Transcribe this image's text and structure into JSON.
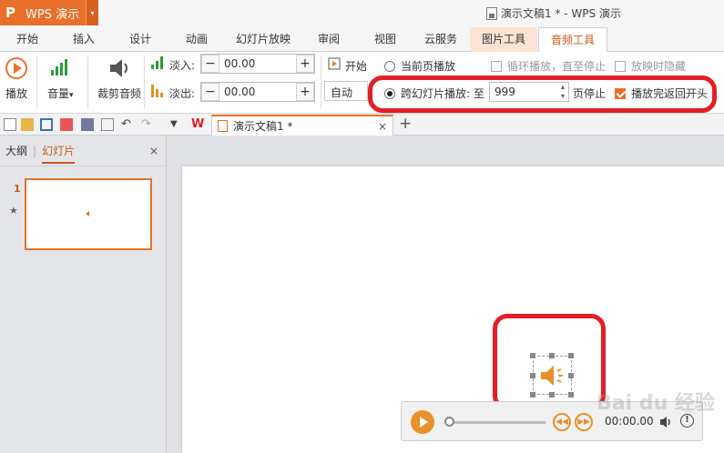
{
  "app": {
    "name": "WPS 演示",
    "logo_glyph": "P",
    "dropdown_glyph": "▾",
    "window_title": "演示文稿1 * - WPS 演示"
  },
  "tabs": [
    "开始",
    "插入",
    "设计",
    "动画",
    "幻灯片放映",
    "审阅",
    "视图",
    "云服务",
    "图片工具",
    "音频工具"
  ],
  "ribbon": {
    "play_label": "播放",
    "volume_label": "音量",
    "volume_arrow": "▾",
    "trim_label": "裁剪音频",
    "fade_in_label": "淡入:",
    "fade_in_value": "00.00",
    "fade_out_label": "淡出:",
    "fade_out_value": "00.00",
    "minus": "−",
    "plus": "+",
    "start_label": "开始",
    "start_mode": "自动",
    "current_page_label": "当前页播放",
    "cross_slide_label": "跨幻灯片播放: 至",
    "cross_slide_value": "999",
    "page_stop_label": "页停止",
    "loop_label": "循环播放，直至停止",
    "hide_label": "放映时隐藏",
    "rewind_label": "播放完返回开头",
    "spin_up": "▴",
    "spin_down": "▾"
  },
  "quickbar": {
    "doc_tab": "演示文稿1 *",
    "close": "×",
    "new_tab": "+"
  },
  "left_pane": {
    "outline_tab": "大纲",
    "divider": "|",
    "slides_tab": "幻灯片",
    "close": "×",
    "slide_number": "1",
    "star": "★"
  },
  "player": {
    "time": "00:00.00",
    "progress": 0.0
  },
  "watermark": "Bai du 经验",
  "colors": {
    "accent": "#e8702a",
    "highlight": "#e41e25"
  }
}
